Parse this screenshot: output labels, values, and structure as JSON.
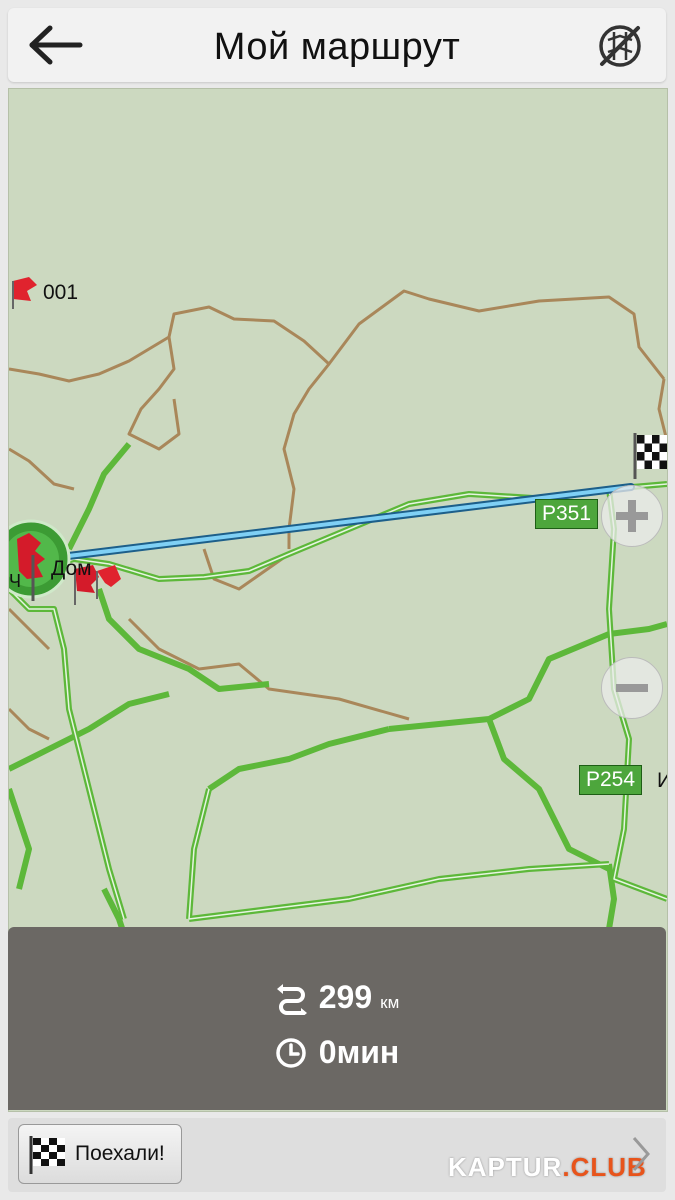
{
  "header": {
    "title": "Мой маршрут",
    "back_icon": "back-arrow-icon",
    "map_toggle_icon": "no-map-icon"
  },
  "map": {
    "labels": {
      "point_001": "001",
      "home": "Дом",
      "edge_left": "Ч",
      "edge_right": "И"
    },
    "roads": [
      {
        "name": "P351"
      },
      {
        "name": "P254"
      }
    ],
    "zoom_in_icon": "plus-icon",
    "zoom_out_icon": "minus-icon",
    "colors": {
      "background": "#ccd9c0",
      "road_green": "#5db83a",
      "road_brown": "#a9875a",
      "route_line": "#4ab3e8",
      "flag_red": "#e0232e"
    }
  },
  "summary": {
    "distance_value": "299",
    "distance_unit": "км",
    "distance_icon": "route-icon",
    "time_value": "0мин",
    "time_icon": "clock-icon"
  },
  "bottom": {
    "go_label": "Поехали!",
    "go_icon": "checkered-flag-icon",
    "brand_main": "KAPTUR",
    "brand_suffix": ".CLUB",
    "next_icon": "chevron-right-icon"
  }
}
